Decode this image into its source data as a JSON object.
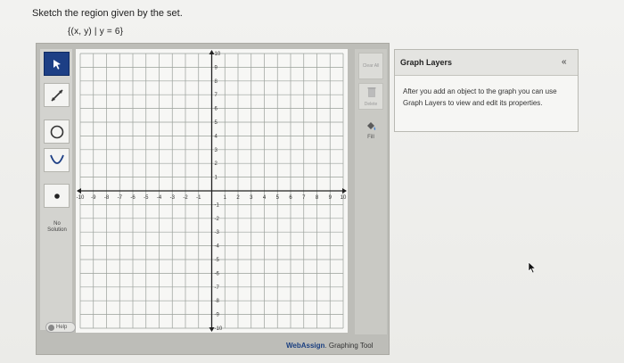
{
  "question": {
    "prompt": "Sketch the region given by the set.",
    "set_notation": "{(x, y) | y = 6}"
  },
  "toolbar": {
    "tools": [
      {
        "id": "pointer",
        "icon": "pointer-arrow-icon",
        "active": true
      },
      {
        "id": "line",
        "icon": "line-tool-icon"
      },
      {
        "id": "circle",
        "icon": "circle-tool-icon"
      },
      {
        "id": "parabola",
        "icon": "parabola-tool-icon"
      },
      {
        "id": "point",
        "icon": "point-tool-icon"
      }
    ],
    "no_solution_label": "No Solution",
    "help_label": "Help"
  },
  "side_buttons": {
    "clear_all_label": "Clear All",
    "delete_label": "Delete",
    "fill_label": "Fill"
  },
  "graph": {
    "x_ticks": [
      -10,
      -9,
      -8,
      -7,
      -6,
      -5,
      -4,
      -3,
      -2,
      -1,
      1,
      2,
      3,
      4,
      5,
      6,
      7,
      8,
      9,
      10
    ],
    "y_ticks": [
      10,
      9,
      8,
      7,
      6,
      5,
      4,
      3,
      2,
      1,
      -1,
      -2,
      -3,
      -4,
      -5,
      -6,
      -7,
      -8,
      -9,
      -10
    ],
    "xlim": [
      -10,
      10
    ],
    "ylim": [
      -10,
      10
    ],
    "grid": true
  },
  "branding": {
    "name": "WebAssign",
    "suffix": ". Graphing Tool"
  },
  "layers_panel": {
    "title": "Graph Layers",
    "collapse_label": "«",
    "help_text": "After you add an object to the graph you can use Graph Layers to view and edit its properties."
  },
  "colors": {
    "active_tool": "#1d3f85",
    "brand": "#1a3f80"
  }
}
